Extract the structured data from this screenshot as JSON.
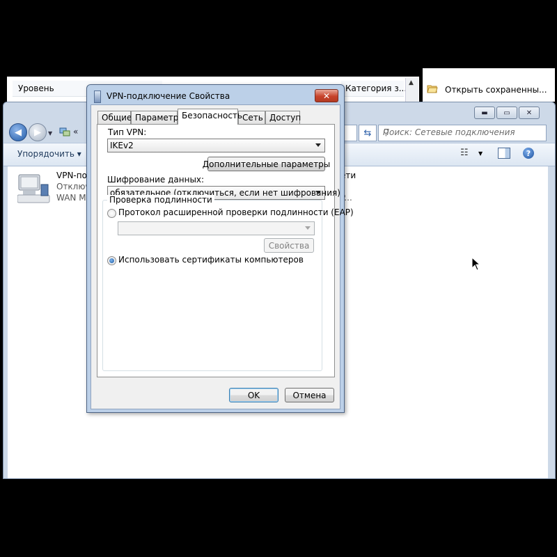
{
  "background": {
    "col1_label": "Уровень",
    "col2_label": "Категория з...",
    "right_label": "Открыть сохраненны..."
  },
  "explorer": {
    "address_chevron": "«",
    "search_placeholder": "Поиск: Сетевые подключения",
    "toolbar": {
      "organize_label": "Упорядочить ▾"
    },
    "items": [
      {
        "name": "VPN-под",
        "status": "Отключ",
        "device": "WAN Mi"
      },
      {
        "name": "ети",
        "device": "P..."
      }
    ]
  },
  "dialog": {
    "title": "VPN-подключение Свойства",
    "close_symbol": "✕",
    "tabs": [
      {
        "label": "Общие"
      },
      {
        "label": "Параметры"
      },
      {
        "label": "Безопасность"
      },
      {
        "label": "Сеть"
      },
      {
        "label": "Доступ"
      }
    ],
    "active_tab": "Безопасность",
    "vpn_type_label": "Тип VPN:",
    "vpn_type_value": "IKEv2",
    "advanced_button": "Дополнительные параметры",
    "encryption_label": "Шифрование данных:",
    "encryption_value": "обязательное (отключиться, если нет шифрования)",
    "auth_group_title": "Проверка подлинности",
    "eap_radio_label": "Протокол расширенной проверки подлинности (EAP)",
    "eap_selected": false,
    "eap_combo_value": "",
    "properties_button": "Свойства",
    "cert_radio_label": "Использовать сертификаты компьютеров",
    "cert_selected": true,
    "ok_button": "OK",
    "cancel_button": "Отмена"
  }
}
